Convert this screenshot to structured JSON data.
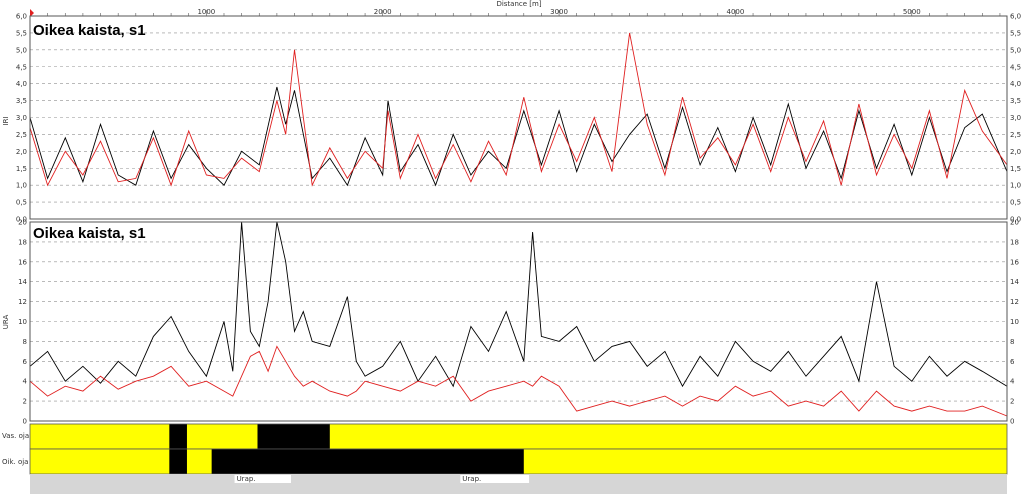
{
  "header": {
    "distance_label": "Distance [m]",
    "distance_ticks": [
      1000,
      2000,
      3000,
      4000,
      5000
    ],
    "x_range": [
      0,
      5540
    ]
  },
  "colors": {
    "series_black": "#000000",
    "series_red": "#e02020",
    "band_yellow": "#ffff00",
    "band_black": "#000000",
    "footer_gray": "#d6d6d6",
    "grid": "#909090"
  },
  "chart_data": [
    {
      "type": "line",
      "title": "Oikea kaista, s1",
      "ylabel": "IRI",
      "ylim": [
        0,
        6
      ],
      "yticks": [
        "0,0",
        "0,5",
        "1,0",
        "1,5",
        "2,0",
        "2,5",
        "3,0",
        "3,5",
        "4,0",
        "4,5",
        "5,0",
        "5,5",
        "6,0"
      ],
      "grid": true,
      "series": [
        {
          "color": "#000000",
          "x": [
            0,
            100,
            200,
            300,
            400,
            500,
            600,
            700,
            800,
            900,
            1000,
            1100,
            1200,
            1300,
            1400,
            1450,
            1500,
            1600,
            1700,
            1800,
            1900,
            2000,
            2030,
            2100,
            2200,
            2300,
            2400,
            2500,
            2600,
            2700,
            2800,
            2900,
            3000,
            3100,
            3200,
            3300,
            3400,
            3500,
            3600,
            3700,
            3800,
            3900,
            4000,
            4100,
            4200,
            4300,
            4400,
            4500,
            4600,
            4700,
            4800,
            4900,
            5000,
            5100,
            5200,
            5300,
            5400,
            5540
          ],
          "y": [
            3.0,
            1.2,
            2.4,
            1.1,
            2.8,
            1.3,
            1.0,
            2.6,
            1.2,
            2.2,
            1.5,
            1.0,
            2.0,
            1.6,
            3.9,
            2.8,
            3.8,
            1.2,
            1.8,
            1.0,
            2.4,
            1.3,
            3.5,
            1.4,
            2.2,
            1.0,
            2.5,
            1.3,
            2.0,
            1.5,
            3.2,
            1.6,
            3.2,
            1.4,
            2.8,
            1.7,
            2.5,
            3.1,
            1.5,
            3.3,
            1.6,
            2.7,
            1.4,
            3.0,
            1.6,
            3.4,
            1.5,
            2.6,
            1.2,
            3.2,
            1.5,
            2.8,
            1.3,
            3.0,
            1.4,
            2.7,
            3.1,
            1.4
          ]
        },
        {
          "color": "#e02020",
          "x": [
            0,
            100,
            200,
            300,
            400,
            500,
            600,
            700,
            800,
            900,
            1000,
            1100,
            1200,
            1300,
            1400,
            1450,
            1500,
            1600,
            1700,
            1800,
            1900,
            2000,
            2030,
            2100,
            2200,
            2300,
            2400,
            2500,
            2600,
            2700,
            2800,
            2900,
            3000,
            3100,
            3200,
            3300,
            3400,
            3500,
            3600,
            3700,
            3800,
            3900,
            4000,
            4100,
            4200,
            4300,
            4400,
            4500,
            4600,
            4700,
            4800,
            4900,
            5000,
            5100,
            5200,
            5300,
            5400,
            5540
          ],
          "y": [
            2.7,
            1.0,
            2.0,
            1.3,
            2.3,
            1.1,
            1.2,
            2.4,
            1.0,
            2.6,
            1.3,
            1.2,
            1.8,
            1.4,
            3.5,
            2.5,
            5.0,
            1.0,
            2.1,
            1.2,
            2.0,
            1.5,
            3.2,
            1.2,
            2.5,
            1.2,
            2.2,
            1.1,
            2.3,
            1.3,
            3.6,
            1.4,
            2.8,
            1.7,
            3.0,
            1.4,
            5.5,
            2.8,
            1.3,
            3.6,
            1.8,
            2.4,
            1.6,
            2.8,
            1.4,
            3.0,
            1.7,
            2.9,
            1.0,
            3.4,
            1.3,
            2.5,
            1.5,
            3.2,
            1.2,
            3.8,
            2.6,
            1.6
          ]
        }
      ]
    },
    {
      "type": "line",
      "title": "Oikea kaista, s1",
      "ylabel": "URA",
      "ylim": [
        0,
        20
      ],
      "yticks": [
        "0",
        "2",
        "4",
        "6",
        "8",
        "10",
        "12",
        "14",
        "16",
        "18",
        "20"
      ],
      "grid": true,
      "series": [
        {
          "color": "#000000",
          "x": [
            0,
            100,
            200,
            300,
            400,
            500,
            600,
            700,
            800,
            900,
            1000,
            1100,
            1150,
            1200,
            1250,
            1300,
            1350,
            1400,
            1450,
            1500,
            1550,
            1600,
            1700,
            1800,
            1850,
            1900,
            2000,
            2100,
            2200,
            2300,
            2400,
            2500,
            2600,
            2700,
            2800,
            2850,
            2900,
            3000,
            3100,
            3200,
            3300,
            3400,
            3500,
            3600,
            3700,
            3800,
            3900,
            4000,
            4100,
            4200,
            4300,
            4400,
            4500,
            4600,
            4700,
            4800,
            4900,
            5000,
            5100,
            5200,
            5300,
            5400,
            5540
          ],
          "y": [
            5.5,
            7.0,
            4.0,
            5.5,
            3.8,
            6.0,
            4.5,
            8.5,
            10.5,
            7.0,
            4.5,
            10.0,
            5.0,
            20.0,
            9.0,
            7.5,
            12.0,
            20.0,
            16.0,
            9.0,
            11.0,
            8.0,
            7.5,
            12.5,
            6.0,
            4.5,
            5.5,
            8.0,
            4.0,
            6.5,
            3.5,
            9.5,
            7.0,
            11.0,
            6.0,
            19.0,
            8.5,
            8.0,
            9.5,
            6.0,
            7.5,
            8.0,
            5.5,
            7.0,
            3.5,
            6.5,
            4.5,
            8.0,
            6.0,
            5.0,
            7.0,
            4.5,
            6.5,
            8.5,
            4.0,
            14.0,
            5.5,
            4.0,
            6.5,
            4.5,
            6.0,
            5.0,
            3.5
          ]
        },
        {
          "color": "#e02020",
          "x": [
            0,
            100,
            200,
            300,
            400,
            500,
            600,
            700,
            800,
            900,
            1000,
            1100,
            1150,
            1200,
            1250,
            1300,
            1350,
            1400,
            1450,
            1500,
            1550,
            1600,
            1700,
            1800,
            1850,
            1900,
            2000,
            2100,
            2200,
            2300,
            2400,
            2500,
            2600,
            2700,
            2800,
            2850,
            2900,
            3000,
            3100,
            3200,
            3300,
            3400,
            3500,
            3600,
            3700,
            3800,
            3900,
            4000,
            4100,
            4200,
            4300,
            4400,
            4500,
            4600,
            4700,
            4800,
            4900,
            5000,
            5100,
            5200,
            5300,
            5400,
            5540
          ],
          "y": [
            4.0,
            2.5,
            3.5,
            3.0,
            4.5,
            3.2,
            4.0,
            4.5,
            5.5,
            3.5,
            4.0,
            3.0,
            2.5,
            4.5,
            6.5,
            7.0,
            5.0,
            7.5,
            6.0,
            4.5,
            3.5,
            4.0,
            3.0,
            2.5,
            3.0,
            4.0,
            3.5,
            3.0,
            4.0,
            3.5,
            4.5,
            2.0,
            3.0,
            3.5,
            4.0,
            3.5,
            4.5,
            3.5,
            1.0,
            1.5,
            2.0,
            1.5,
            2.0,
            2.5,
            1.5,
            2.5,
            2.0,
            3.5,
            2.5,
            3.0,
            1.5,
            2.0,
            1.5,
            3.0,
            1.0,
            3.0,
            1.5,
            1.0,
            1.5,
            1.0,
            1.0,
            1.5,
            0.5
          ]
        }
      ]
    }
  ],
  "bands": {
    "rows": [
      {
        "label": "Vas. oja",
        "black_segments": [
          [
            790,
            890
          ],
          [
            1290,
            1700
          ]
        ]
      },
      {
        "label": "Oik. oja",
        "black_segments": [
          [
            790,
            890
          ],
          [
            1030,
            2800
          ]
        ]
      }
    ],
    "urap": [
      {
        "label": "Urap.",
        "range": [
          1160,
          1480
        ]
      },
      {
        "label": "Urap.",
        "range": [
          2440,
          2830
        ]
      }
    ]
  }
}
